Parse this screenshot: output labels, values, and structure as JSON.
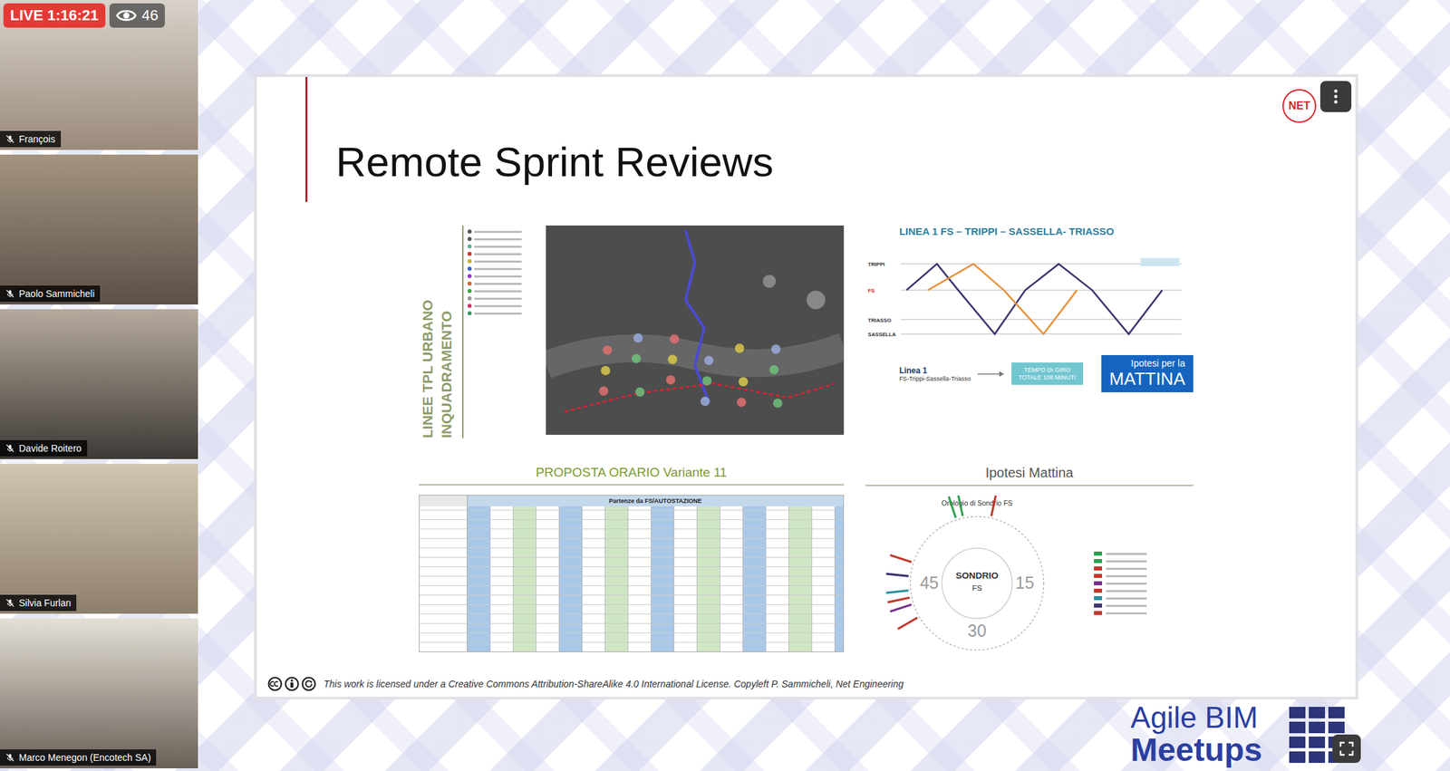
{
  "stream": {
    "live": "LIVE",
    "elapsed": "1:16:21",
    "viewers": "46"
  },
  "participants": [
    {
      "name": "François",
      "muted": true
    },
    {
      "name": "Paolo Sammicheli",
      "muted": true
    },
    {
      "name": "Davide Roitero",
      "muted": true
    },
    {
      "name": "Silvia Furlan",
      "muted": true
    },
    {
      "name": "Marco Menegon (Encotech SA)",
      "muted": true
    }
  ],
  "slide": {
    "title": "Remote Sprint Reviews",
    "logo": "NET",
    "map": {
      "label_lines": [
        "INQUADRAMENTO",
        "LINEE TPL URBANO"
      ]
    },
    "line_chart": {
      "title": "LINEA 1 FS – TRIPPI – SASSELLA- TRIASSO",
      "stations": [
        "TRIPPI",
        "FS",
        "TRIASSO",
        "SASSELLA"
      ],
      "series": [
        {
          "color": "#3d3470",
          "points": [
            [
              0,
              1
            ],
            [
              20,
              0
            ],
            [
              34,
              1
            ],
            [
              58,
              3
            ],
            [
              78,
              1
            ],
            [
              100,
              0
            ],
            [
              122,
              1
            ],
            [
              146,
              3
            ],
            [
              168,
              1
            ]
          ]
        },
        {
          "color": "#e8913a",
          "points": [
            [
              14,
              1
            ],
            [
              44,
              0
            ],
            [
              64,
              1
            ],
            [
              90,
              3
            ],
            [
              112,
              1
            ]
          ]
        }
      ],
      "caption_title": "Linea 1",
      "caption_sub": "FS-Trippi-Sassella-Triasso",
      "total": "TEMPO DI GIRO TOTALE 108 MINUTI",
      "badge_top": "Ipotesi per la",
      "badge_main": "MATTINA"
    },
    "timetable": {
      "title": "PROPOSTA ORARIO Variante 11",
      "header": "Partenze da FS/AUTOSTAZIONE"
    },
    "clock": {
      "title": "Ipotesi Mattina",
      "subtitle": "Orologio di Sondrio FS",
      "center": [
        "SONDRIO",
        "FS"
      ],
      "ticks": [
        {
          "label": "15",
          "minute": 15
        },
        {
          "label": "30",
          "minute": 30
        },
        {
          "label": "45",
          "minute": 45
        }
      ],
      "rays": [
        {
          "minute": 58,
          "color": "#2e9e4f"
        },
        {
          "minute": 57,
          "color": "#2e9e4f"
        },
        {
          "minute": 2,
          "color": "#c0392b"
        },
        {
          "minute": 40,
          "color": "#c0392b"
        },
        {
          "minute": 42,
          "color": "#7b2d8e"
        },
        {
          "minute": 43,
          "color": "#c0392b"
        },
        {
          "minute": 44,
          "color": "#2a8f9e"
        },
        {
          "minute": 46,
          "color": "#3d3470"
        },
        {
          "minute": 48,
          "color": "#c0392b"
        }
      ]
    },
    "license": "This work is licensed under a Creative Commons Attribution-ShareAlike 4.0 International License. Copyleft P. Sammicheli, Net Engineering"
  },
  "brand": {
    "line1": "Agile BIM",
    "line2": "Meetups"
  }
}
